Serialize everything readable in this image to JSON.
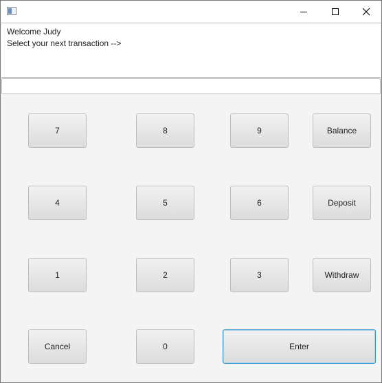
{
  "window": {
    "controls": {
      "minimize_icon": "minimize-icon",
      "maximize_icon": "maximize-icon",
      "close_icon": "close-icon"
    }
  },
  "output": {
    "line1": "Welcome Judy",
    "line2": "Select your next transaction -->"
  },
  "input": {
    "value": "",
    "placeholder": ""
  },
  "keypad": {
    "k7": "7",
    "k8": "8",
    "k9": "9",
    "balance": "Balance",
    "k4": "4",
    "k5": "5",
    "k6": "6",
    "deposit": "Deposit",
    "k1": "1",
    "k2": "2",
    "k3": "3",
    "withdraw": "Withdraw",
    "cancel": "Cancel",
    "k0": "0",
    "enter": "Enter"
  },
  "colors": {
    "focus_border": "#2b95d6",
    "background": "#f4f4f4"
  }
}
